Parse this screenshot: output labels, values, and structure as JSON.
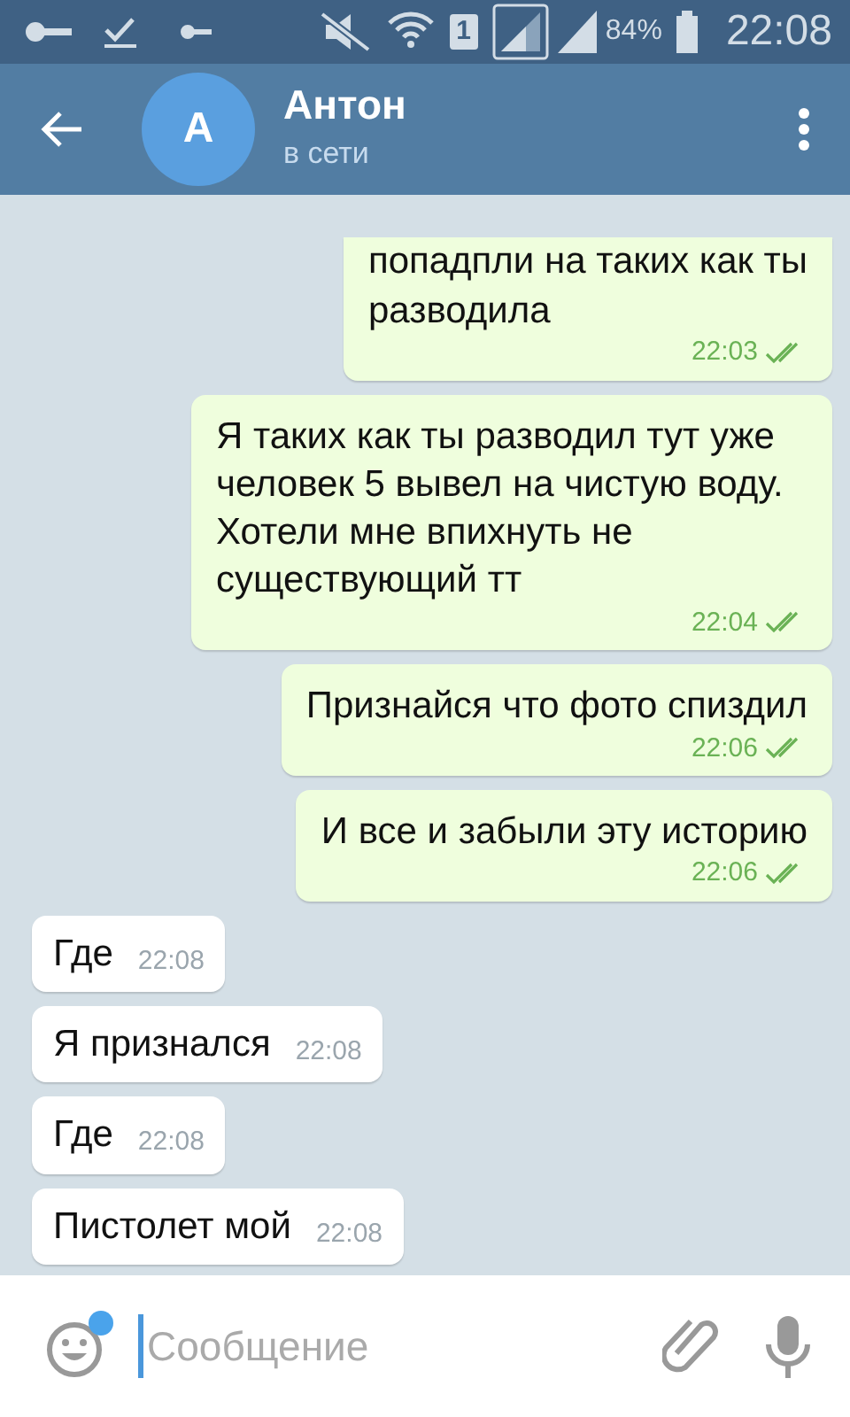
{
  "status_bar": {
    "sim": "1",
    "battery": "84%",
    "time": "22:08"
  },
  "header": {
    "avatar_letter": "А",
    "name": "Антон",
    "status": "в сети"
  },
  "messages": [
    {
      "kind": "out",
      "text": "попадпли на таких как ты\nразводила",
      "time": "22:03",
      "read": true
    },
    {
      "kind": "out",
      "text": "Я таких как ты разводил тут уже человек 5 вывел на чистую воду. Хотели мне впихнуть не существующий тт",
      "time": "22:04",
      "read": true
    },
    {
      "kind": "out",
      "text": "Признайся что фото спиздил",
      "time": "22:06",
      "read": true
    },
    {
      "kind": "out",
      "text": "И все и забыли эту историю",
      "time": "22:06",
      "read": true
    },
    {
      "kind": "in",
      "text": "Где",
      "time": "22:08"
    },
    {
      "kind": "in",
      "text": "Я признался",
      "time": "22:08"
    },
    {
      "kind": "in",
      "text": "Где",
      "time": "22:08"
    },
    {
      "kind": "in",
      "text": "Пистолет мой",
      "time": "22:08"
    }
  ],
  "composer": {
    "placeholder": "Сообщение",
    "emoji_badge": true
  }
}
